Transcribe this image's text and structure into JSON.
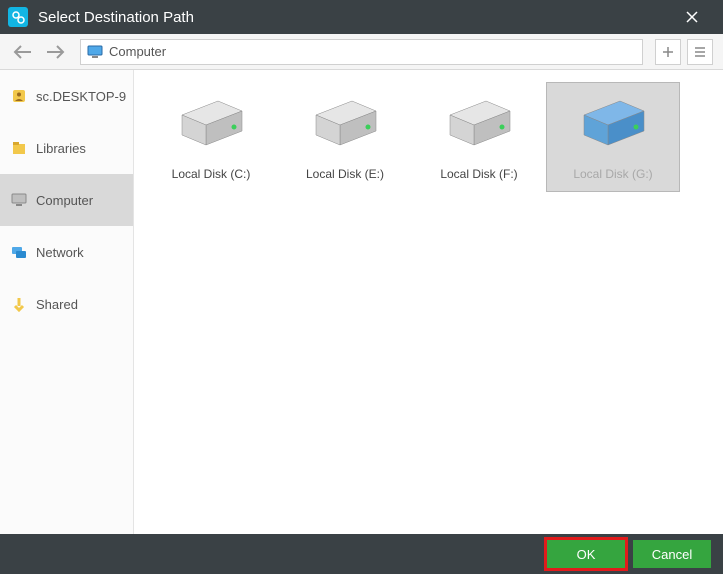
{
  "title": "Select Destination Path",
  "path_label": "Computer",
  "sidebar": {
    "items": [
      {
        "label": "sc.DESKTOP-9",
        "selected": false,
        "icon": "user"
      },
      {
        "label": "Libraries",
        "selected": false,
        "icon": "libraries"
      },
      {
        "label": "Computer",
        "selected": true,
        "icon": "computer"
      },
      {
        "label": "Network",
        "selected": false,
        "icon": "network"
      },
      {
        "label": "Shared",
        "selected": false,
        "icon": "shared"
      }
    ]
  },
  "disks": [
    {
      "label": "Local Disk (C:)",
      "selected": false,
      "color": "gray"
    },
    {
      "label": "Local Disk (E:)",
      "selected": false,
      "color": "gray"
    },
    {
      "label": "Local Disk (F:)",
      "selected": false,
      "color": "gray"
    },
    {
      "label": "Local Disk (G:)",
      "selected": true,
      "color": "blue"
    }
  ],
  "footer": {
    "ok": "OK",
    "cancel": "Cancel"
  }
}
